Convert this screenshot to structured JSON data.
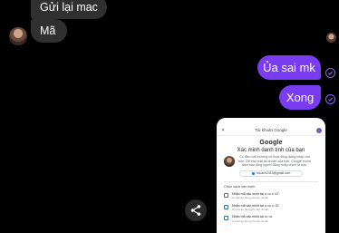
{
  "messages_in": [
    {
      "text": "Gửi lại mac"
    },
    {
      "text": "Mã"
    }
  ],
  "messages_out": [
    {
      "text": "Ủa sai mk"
    },
    {
      "text": "Xong"
    }
  ],
  "colors": {
    "outgoing": "#7a3cf0",
    "incoming": "#303030",
    "background": "#000000"
  },
  "icons": {
    "share": "share-icon",
    "status": "check-circle-icon"
  },
  "phone": {
    "header_title": "Tài khoản Google",
    "logo": "Google",
    "heading": "Xác minh danh tính của bạn",
    "paragraph": "Có điều bất thường về hoạt động đăng nhập của bạn. Để bảo mật tài khoản của bạn, Google muốn đảm bảo rằng người đăng nhập chính là bạn.",
    "email": "nhuanh2413@gmail.com",
    "section_title": "Chọn cách xác minh",
    "options": [
      {
        "label": "Nhận mã xác minh tại •• ••• •• 47",
        "sub": "Có thể áp dụng phí tiêu chuẩn"
      },
      {
        "label": "Nhận mã xác minh tại •• ••• •• 32",
        "sub": "Có thể áp dụng phí tiêu chuẩn"
      },
      {
        "label": "Nhận mã xác minh tại ••• •••",
        "sub": "Có thể áp dụng phí tiêu chuẩn"
      }
    ]
  }
}
